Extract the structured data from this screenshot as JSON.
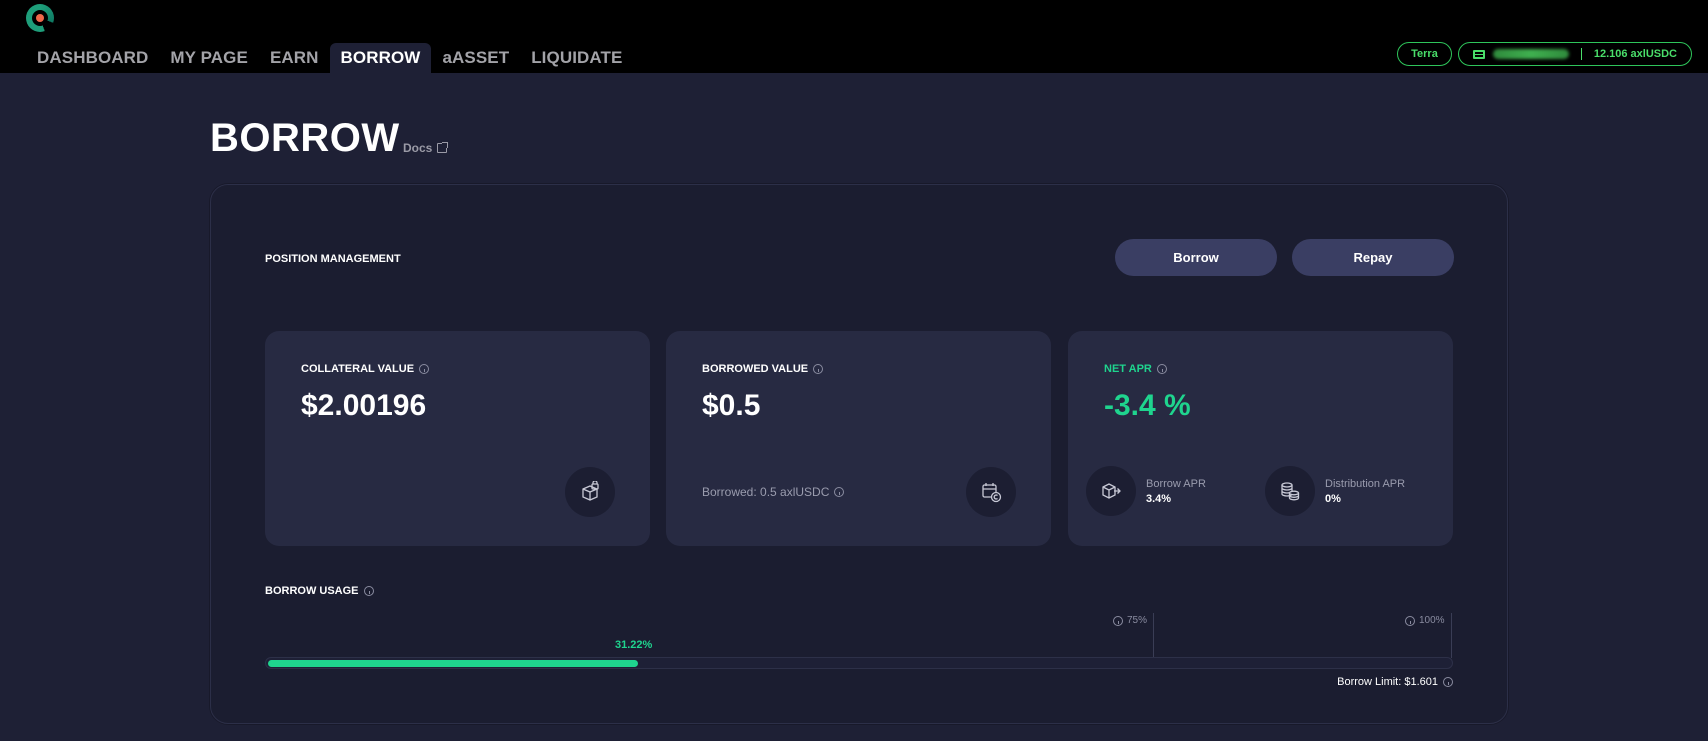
{
  "nav": {
    "items": [
      {
        "label": "DASHBOARD",
        "active": false
      },
      {
        "label": "MY PAGE",
        "active": false
      },
      {
        "label": "EARN",
        "active": false
      },
      {
        "label": "BORROW",
        "active": true
      },
      {
        "label": "aASSET",
        "active": false
      },
      {
        "label": "LIQUIDATE",
        "active": false
      }
    ]
  },
  "header": {
    "network": "Terra",
    "wallet_balance": "12.106 axlUSDC",
    "icons": [
      "app-logo",
      "wallet-icon"
    ]
  },
  "page": {
    "title": "BORROW",
    "docs_label": "Docs"
  },
  "position": {
    "label": "POSITION MANAGEMENT",
    "borrow_button": "Borrow",
    "repay_button": "Repay"
  },
  "cards": {
    "collateral": {
      "label": "COLLATERAL VALUE",
      "value": "$2.00196"
    },
    "borrowed": {
      "label": "BORROWED VALUE",
      "value": "$0.5",
      "sub": "Borrowed: 0.5 axlUSDC"
    },
    "net_apr": {
      "label": "NET APR",
      "value": "-3.4 %",
      "borrow_apr_label": "Borrow APR",
      "borrow_apr_value": "3.4%",
      "distribution_apr_label": "Distribution APR",
      "distribution_apr_value": "0%"
    }
  },
  "usage": {
    "label": "BORROW USAGE",
    "percent_label": "31.22%",
    "fraction": 0.3122,
    "tick_75_label": "75%",
    "tick_100_label": "100%",
    "borrow_limit": "Borrow Limit: $1.601"
  },
  "colors": {
    "accent_green": "#1fd48e",
    "wallet_green": "#4ade6a",
    "button_bg": "#3a3e63",
    "card_bg": "#272a42",
    "page_bg": "#1e2035"
  }
}
